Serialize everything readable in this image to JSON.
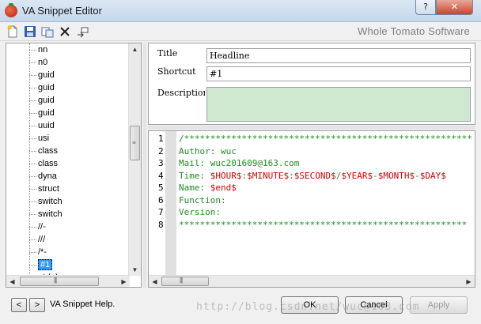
{
  "window": {
    "title": "VA Snippet Editor",
    "help_button": "?",
    "close_button": "✕"
  },
  "toolbar": {
    "brand": "Whole Tomato Software",
    "icons": [
      "new-snippet-icon",
      "save-icon",
      "copy-icon",
      "delete-icon",
      "insert-icon"
    ]
  },
  "tree": {
    "items": [
      "nn",
      "n0",
      "guid",
      "guid",
      "guid",
      "guid",
      "uuid",
      "usi",
      "class",
      "class",
      "dyna",
      "struct",
      "switch",
      "switch",
      "//-",
      "///",
      "/*-",
      "#1"
    ],
    "selected_index": 17,
    "partial_item": "..t.(..)"
  },
  "properties": {
    "title_label": "Title",
    "title_value": "Headline",
    "shortcut_label": "Shortcut",
    "shortcut_value": "#1",
    "description_label": "Description",
    "description_value": ""
  },
  "editor": {
    "lines": [
      {
        "num": "1",
        "parts": [
          {
            "t": "/*******************************************************",
            "c": "c"
          }
        ]
      },
      {
        "num": "2",
        "parts": [
          {
            "t": "Author: wuc",
            "c": "c"
          }
        ]
      },
      {
        "num": "3",
        "parts": [
          {
            "t": "Mail: wuc201609@163.com",
            "c": "c"
          }
        ]
      },
      {
        "num": "4",
        "parts": [
          {
            "t": "Time: ",
            "c": "c"
          },
          {
            "t": "$HOUR$",
            "c": "v"
          },
          {
            "t": ":",
            "c": "c"
          },
          {
            "t": "$MINUTE$",
            "c": "v"
          },
          {
            "t": ":",
            "c": "c"
          },
          {
            "t": "$SECOND$",
            "c": "v"
          },
          {
            "t": "/",
            "c": "c"
          },
          {
            "t": "$YEAR$",
            "c": "v"
          },
          {
            "t": "-",
            "c": "c"
          },
          {
            "t": "$MONTH$",
            "c": "v"
          },
          {
            "t": "-",
            "c": "c"
          },
          {
            "t": "$DAY$",
            "c": "v"
          }
        ]
      },
      {
        "num": "5",
        "parts": [
          {
            "t": "Name: ",
            "c": "c"
          },
          {
            "t": "$end$",
            "c": "v"
          }
        ]
      },
      {
        "num": "6",
        "parts": [
          {
            "t": "Function:",
            "c": "c"
          }
        ]
      },
      {
        "num": "7",
        "parts": [
          {
            "t": "Version:",
            "c": "c"
          }
        ]
      },
      {
        "num": "8",
        "parts": [
          {
            "t": "*******************************************************",
            "c": "c"
          }
        ]
      }
    ]
  },
  "bottom": {
    "prev_label": "<",
    "next_label": ">",
    "help_link": "VA Snippet Help.",
    "ok_label": "OK",
    "cancel_label": "Cancel",
    "apply_label": "Apply",
    "watermark": "http://blog.csdn.net/wuc@163.com"
  },
  "colors": {
    "comment": "#228b22",
    "variable": "#d40000",
    "description_bg": "#cfe9d1",
    "selection": "#3399ff"
  }
}
